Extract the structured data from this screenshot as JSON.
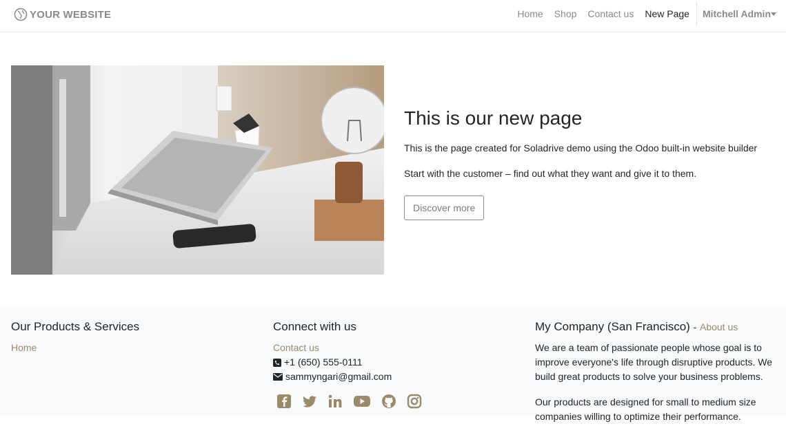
{
  "header": {
    "logo_text": "YOUR WEBSITE",
    "nav": [
      "Home",
      "Shop",
      "Contact us",
      "New Page"
    ],
    "active": "New Page",
    "user": "Mitchell Admin"
  },
  "hero": {
    "title": "This is our new page",
    "p1": "This is the page created for Soladrive demo using the Odoo built-in website builder",
    "p2": "Start with the customer – find out what they want and give it to them.",
    "button": "Discover more"
  },
  "footer": {
    "col1": {
      "title": "Our Products & Services",
      "link": "Home"
    },
    "col2": {
      "title": "Connect with us",
      "contact": "Contact us",
      "phone": "+1 (650) 555-0111",
      "email": "sammyngari@gmail.com",
      "social_icons": [
        "facebook-icon",
        "twitter-icon",
        "linkedin-icon",
        "youtube-icon",
        "github-icon",
        "instagram-icon"
      ]
    },
    "col3": {
      "title": "My Company (San Francisco)",
      "dash": "-",
      "about": "About us",
      "p1": "We are a team of passionate people whose goal is to improve everyone's life through disruptive products. We build great products to solve your business problems.",
      "p2": "Our products are designed for small to medium size companies willing to optimize their performance."
    }
  },
  "colors": {
    "link": "#9a8a6a",
    "muted": "#8a8a8a",
    "footer_bg": "#f8f9fa"
  }
}
